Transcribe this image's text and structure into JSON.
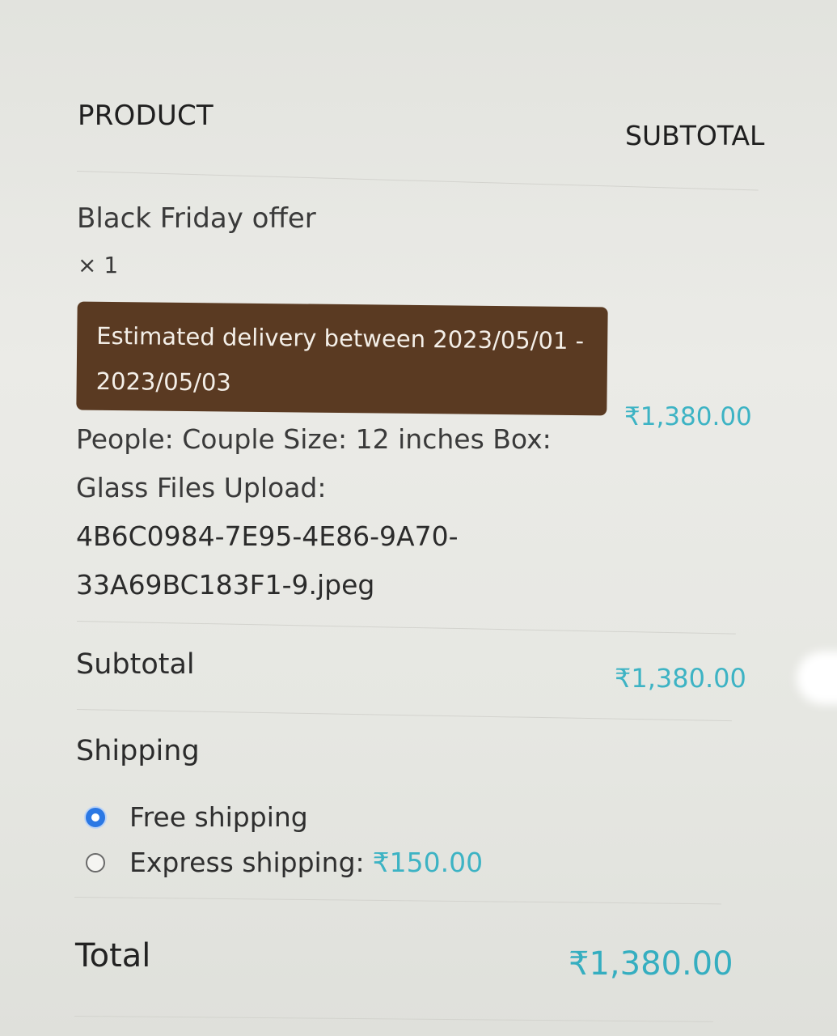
{
  "table": {
    "header_product": "PRODUCT",
    "header_subtotal": "SUBTOTAL"
  },
  "item": {
    "name": "Black Friday offer",
    "quantity": "× 1",
    "delivery_line1": "Estimated delivery between 2023/05/01 -",
    "delivery_line2": "2023/05/03",
    "meta_line1": "People: Couple Size: 12 inches Box:",
    "meta_line2": "Glass Files Upload:",
    "file_line1": "4B6C0984-7E95-4E86-9A70-",
    "file_line2": "33A69BC183F1-9.jpeg",
    "price": "₹1,380.00"
  },
  "summary": {
    "subtotal_label": "Subtotal",
    "subtotal_value": "₹1,380.00",
    "shipping_label": "Shipping",
    "shipping_options": [
      {
        "label": "Free shipping",
        "price": "",
        "selected": true
      },
      {
        "label": "Express shipping:",
        "price": "₹150.00",
        "selected": false
      }
    ],
    "total_label": "Total",
    "total_value": "₹1,380.00"
  },
  "colors": {
    "price_accent": "#3db3c4",
    "badge_bg": "#5a3a22",
    "radio_selected": "#2b78e4"
  }
}
